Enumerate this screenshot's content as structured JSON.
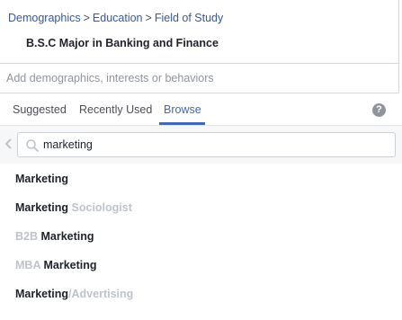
{
  "breadcrumb": {
    "items": [
      "Demographics",
      "Education",
      "Field of Study"
    ],
    "separator": ">"
  },
  "selected": {
    "label": "B.S.C Major in Banking and Finance"
  },
  "add_input": {
    "placeholder": "Add demographics, interests or behaviors"
  },
  "tabs": [
    {
      "label": "Suggested",
      "active": false
    },
    {
      "label": "Recently Used",
      "active": false
    },
    {
      "label": "Browse",
      "active": true
    }
  ],
  "help": {
    "glyph": "?"
  },
  "search": {
    "value": "marketing"
  },
  "results": [
    {
      "parts": [
        {
          "text": "Marketing",
          "muted": false
        }
      ]
    },
    {
      "parts": [
        {
          "text": "Marketing ",
          "muted": false
        },
        {
          "text": "Sociologist",
          "muted": true
        }
      ]
    },
    {
      "parts": [
        {
          "text": "B2B ",
          "muted": true
        },
        {
          "text": "Marketing",
          "muted": false
        }
      ]
    },
    {
      "parts": [
        {
          "text": "MBA ",
          "muted": true
        },
        {
          "text": "Marketing",
          "muted": false
        }
      ]
    },
    {
      "parts": [
        {
          "text": "Marketing",
          "muted": false
        },
        {
          "text": "/Advertising",
          "muted": true
        }
      ]
    }
  ],
  "colors": {
    "link": "#365899",
    "active_tab": "#4267b2",
    "text": "#1d2129",
    "muted": "#bec3c9"
  }
}
